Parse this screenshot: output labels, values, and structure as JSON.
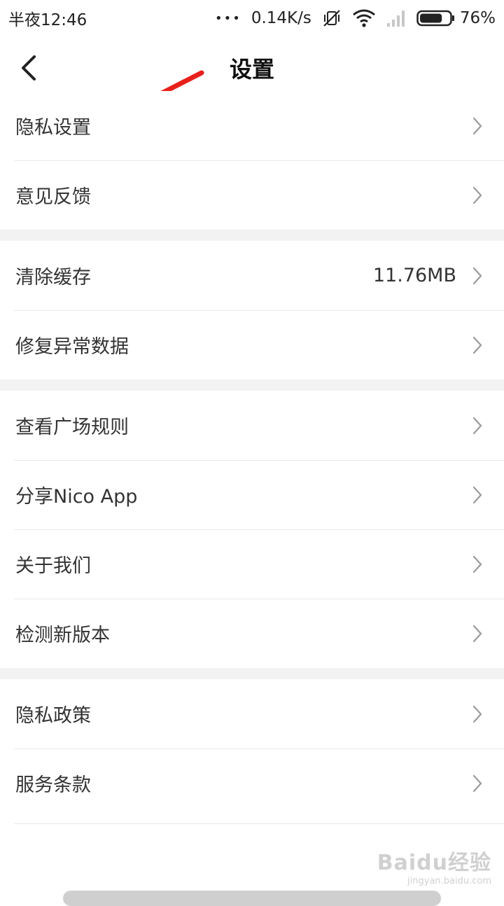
{
  "status_bar": {
    "time": "半夜12:46",
    "dots": "•••",
    "speed": "0.14K/s",
    "battery_percent": "76%",
    "battery_level": 0.76,
    "icons": [
      "mute-vibrate-icon",
      "wifi-icon",
      "signal-icon",
      "battery-icon"
    ]
  },
  "header": {
    "title": "设置",
    "back_icon": "chevron-left-icon"
  },
  "groups": [
    {
      "items": [
        {
          "label": "隐私设置"
        },
        {
          "label": "意见反馈"
        }
      ]
    },
    {
      "items": [
        {
          "label": "清除缓存",
          "value": "11.76MB"
        },
        {
          "label": "修复异常数据"
        }
      ]
    },
    {
      "items": [
        {
          "label": "查看广场规则"
        },
        {
          "label": "分享Nico App"
        },
        {
          "label": "关于我们"
        },
        {
          "label": "检测新版本"
        }
      ]
    },
    {
      "items": [
        {
          "label": "隐私政策"
        },
        {
          "label": "服务条款"
        }
      ]
    }
  ],
  "annotation": {
    "color": "#e8201c"
  },
  "watermark": {
    "main": "Baidu经验",
    "sub": "jingyan.baidu.com"
  }
}
